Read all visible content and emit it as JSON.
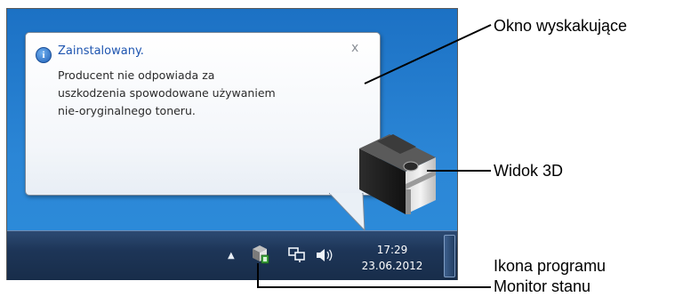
{
  "popup": {
    "title": "Zainstalowany.",
    "close_label": "x",
    "lines": [
      "Producent nie odpowiada za",
      "uszkodzenia spowodowane używaniem",
      "nie-oryginalnego toneru."
    ]
  },
  "taskbar": {
    "time": "17:29",
    "date": "23.06.2012",
    "tray_arrow": "▲"
  },
  "callouts": {
    "popup_label": "Okno wyskakujące",
    "view3d_label": "Widok 3D",
    "icon_label_line1": "Ikona programu",
    "icon_label_line2": "Monitor stanu"
  },
  "colors": {
    "desktop": "#2b86d6",
    "taskbar": "#1d3557",
    "popup_title": "#1e55b0"
  },
  "icons": [
    "info-icon",
    "close-icon",
    "status-monitor-icon",
    "network-icon",
    "volume-icon",
    "printer-3d-icon"
  ]
}
